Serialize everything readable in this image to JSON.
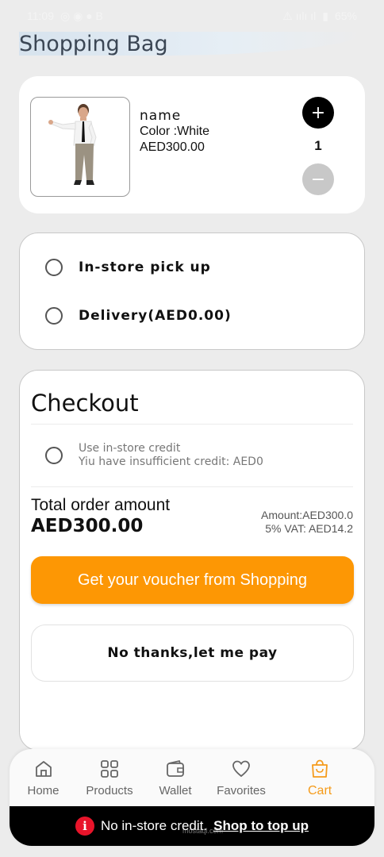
{
  "status_bar": {
    "time": "11:09",
    "battery": "65%"
  },
  "header": {
    "title": "Shopping Bag"
  },
  "cart_item": {
    "name": "name",
    "color": "Color :White",
    "price": "AED300.00",
    "quantity": "1",
    "plus_label": "+",
    "minus_label": "−"
  },
  "fulfillment": {
    "options": [
      {
        "label": "In-store pick up",
        "selected": false
      },
      {
        "label": "Delivery(AED0.00)",
        "selected": false
      }
    ]
  },
  "checkout": {
    "title": "Checkout",
    "credit_option": "Use in-store credit",
    "credit_note": "Yiu have insufficient credit: AED0",
    "total_label": "Total order amount",
    "total_value": "AED300.00",
    "amount": "Amount:AED300.0",
    "vat": "5% VAT: AED14.2",
    "voucher_button": "Get your voucher from Shopping",
    "no_thanks_button": "No thanks,let me pay"
  },
  "bottom_nav": {
    "items": [
      {
        "label": "Home",
        "icon": "home-icon"
      },
      {
        "label": "Products",
        "icon": "grid-icon"
      },
      {
        "label": "Wallet",
        "icon": "wallet-icon"
      },
      {
        "label": "Favorites",
        "icon": "heart-icon"
      },
      {
        "label": "Cart",
        "icon": "bag-icon",
        "active": true
      }
    ]
  },
  "notice": {
    "text": "No in-store credit.",
    "link": "Shop to top up"
  },
  "watermark": "mostaql.com",
  "colors": {
    "accent": "#fd9704",
    "active_nav": "#f59b1a",
    "notice_icon": "#e8142a"
  }
}
